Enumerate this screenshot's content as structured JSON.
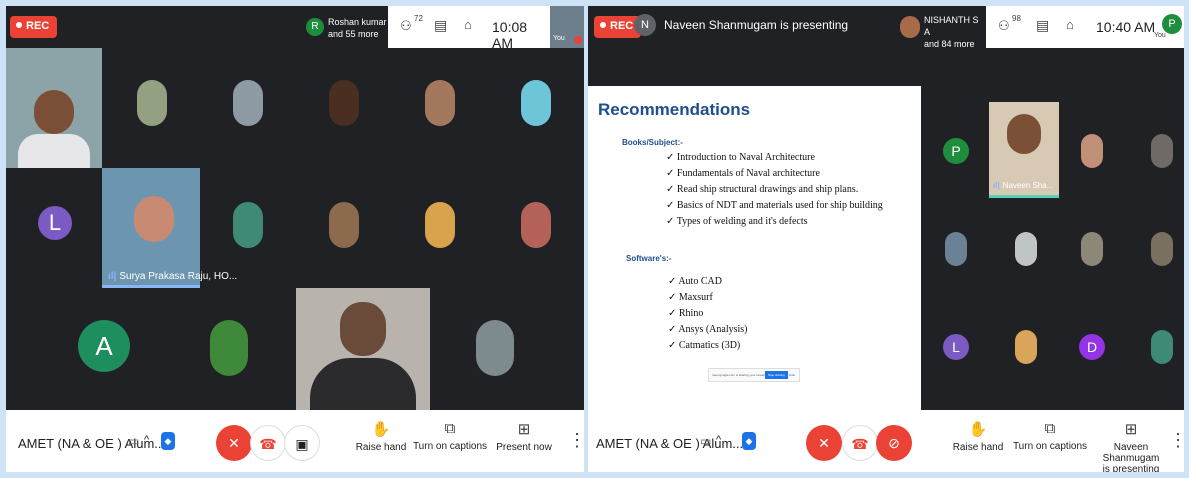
{
  "left": {
    "rec_label": "REC",
    "presenter_initial": "R",
    "presenter_line1": "Roshan kumar",
    "presenter_line2": "and 55 more",
    "participants_count": "72",
    "clock": "10:08 AM",
    "you_label": "You",
    "tiles": {
      "speaker_name": "Surya Prakasa Raju, HO...",
      "avatar_L": "L",
      "avatar_A": "A"
    },
    "bottom": {
      "meeting_title": "AMET (NA & OE ) Alum...",
      "raise_hand": "Raise hand",
      "captions": "Turn on captions",
      "present": "Present now"
    }
  },
  "right": {
    "rec_label": "REC",
    "presenter_initial": "N",
    "presenting_text": "Naveen Shanmugam is presenting",
    "top_pill_line1": "NISHANTH S A",
    "top_pill_line2": "and 84 more",
    "participants_count": "98",
    "clock": "10:40 AM",
    "you_label": "You",
    "you_initial": "P",
    "slide": {
      "title": "Recommendations",
      "books_heading": "Books/Subject:-",
      "books": [
        "Introduction to Naval Architecture",
        "Fundamentals of Naval architecture",
        "Read ship structural drawings and ship plans.",
        "Basics of NDT and materials used for ship building",
        "Types of welding and it's defects"
      ],
      "software_heading": "Software's:-",
      "software": [
        "Auto CAD",
        "Maxsurf",
        "Rhino",
        "Ansys (Analysis)",
        "Catmatics (3D)"
      ],
      "share_bar_text": "meet.google.com is sharing your screen.",
      "stop_sharing": "Stop sharing",
      "hide": "Hide"
    },
    "tiles": {
      "naveen_name": "Naveen Sha...",
      "avatar_P": "P",
      "avatar_L": "L",
      "avatar_D": "D"
    },
    "bottom": {
      "meeting_title": "AMET (NA & OE ) Alum...",
      "raise_hand": "Raise hand",
      "captions": "Turn on captions",
      "presenting_line1": "Naveen Shanmugam",
      "presenting_line2": "is presenting"
    }
  },
  "colors": {
    "rec_red": "#ea4335",
    "end_call_red": "#ea4335",
    "meet_background": "#202124",
    "tile_background": "#3c4043",
    "avatar_purple": "#7b5ac4",
    "avatar_green": "#1e8e5e",
    "avatar_d_purple": "#9334e6",
    "slide_title_blue": "#1f4e8c"
  },
  "icons": [
    "rec-dot-icon",
    "people-icon",
    "chat-icon",
    "activities-icon",
    "chevron-up-icon",
    "shield-icon",
    "mic-off-icon",
    "end-call-icon",
    "camera-icon",
    "camera-off-icon",
    "raise-hand-icon",
    "captions-icon",
    "present-icon",
    "more-vert-icon"
  ]
}
